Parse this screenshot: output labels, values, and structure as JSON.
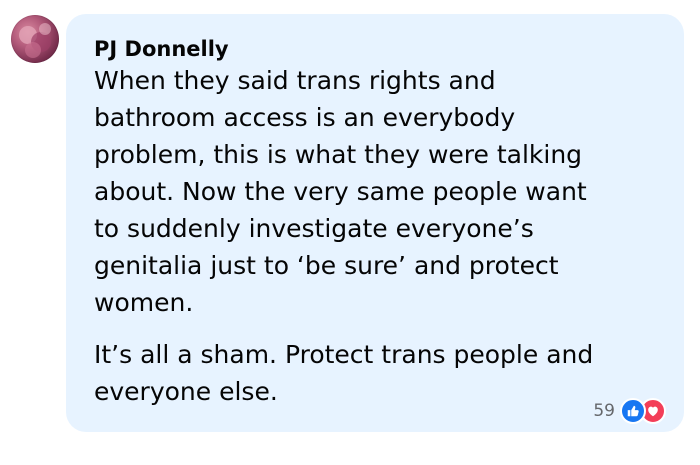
{
  "comment": {
    "author": "PJ Donnelly",
    "paragraphs": [
      "When they said trans rights and\nbathroom access is an everybody\nproblem, this is what they were talking\nabout. Now the very same people want\nto suddenly investigate everyone’s\ngenitalia just to ‘be sure’ and protect\nwomen.",
      "It’s all a sham. Protect trans people and\neveryone else."
    ],
    "reaction_count": "59",
    "reactions": [
      "like-icon",
      "love-icon"
    ]
  },
  "colors": {
    "bubble_bg": "#e7f3ff",
    "like": "#1877f2",
    "love": "#f33e58",
    "meta_text": "#65676b"
  }
}
